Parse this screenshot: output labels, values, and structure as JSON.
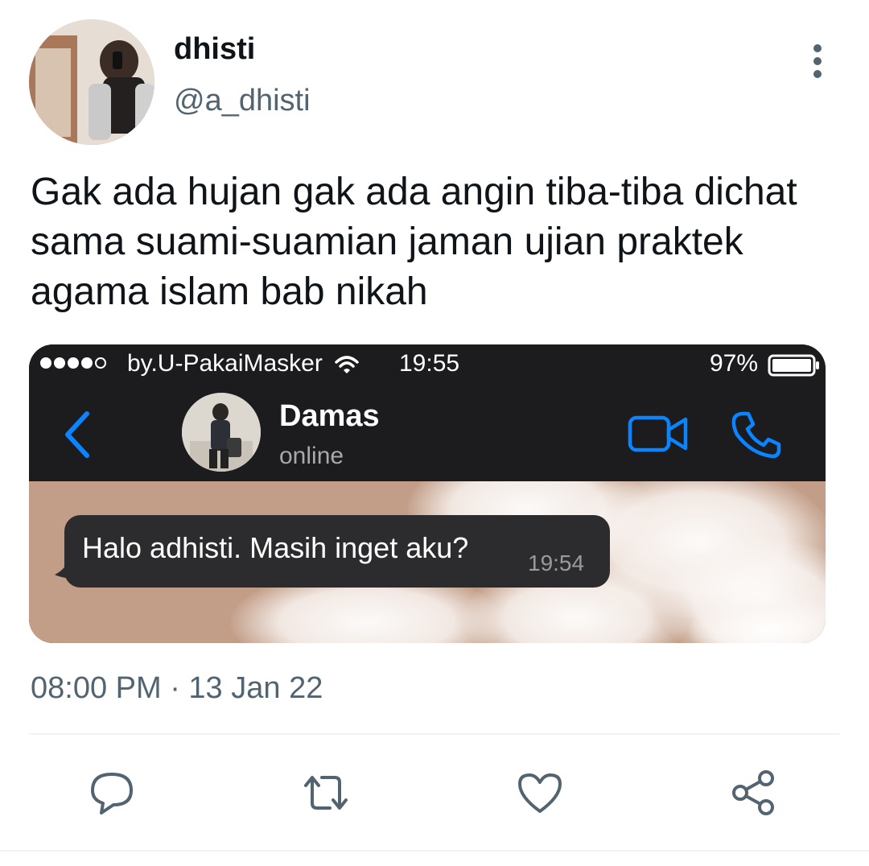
{
  "tweet": {
    "author": {
      "display_name": "dhisti",
      "handle": "@a_dhisti"
    },
    "text": "Gak ada hujan gak ada angin tiba-tiba dichat sama suami-suamian jaman ujian praktek agama islam bab nikah",
    "timestamp": "08:00 PM · 13 Jan 22"
  },
  "media": {
    "status_bar": {
      "carrier": "by.U-PakaiMasker",
      "time": "19:55",
      "battery": "97%"
    },
    "chat_header": {
      "contact_name": "Damas",
      "contact_status": "online"
    },
    "message": {
      "text": "Halo adhisti. Masih inget aku?",
      "time": "19:54"
    }
  },
  "icons": {
    "more": "more-vertical-icon",
    "back": "chevron-left-icon",
    "video": "video-camera-icon",
    "call": "phone-icon",
    "reply": "reply-icon",
    "retweet": "retweet-icon",
    "like": "heart-icon",
    "share": "share-icon"
  },
  "colors": {
    "text_primary": "#0f1419",
    "text_secondary": "#536471",
    "ios_blue": "#0a84ff",
    "chat_header_bg": "#1c1c1e",
    "bubble_bg": "#2c2c2e",
    "chat_wallpaper": "#c29d87"
  }
}
